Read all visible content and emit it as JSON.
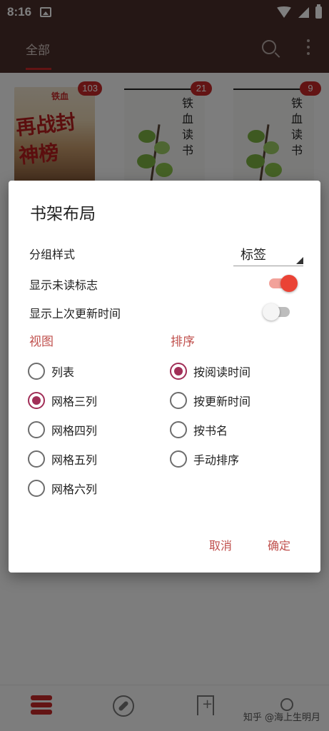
{
  "status_bar": {
    "time": "8:16"
  },
  "app_bar": {
    "tab_all": "全部"
  },
  "books": [
    {
      "brand": "铁血",
      "title": "再战封神榜",
      "badge": "103"
    },
    {
      "title": "铁血读书",
      "badge": "21"
    },
    {
      "title": "铁血读书",
      "badge": "9"
    }
  ],
  "dialog": {
    "title": "书架布局",
    "group_style_label": "分组样式",
    "group_style_value": "标签",
    "show_unread_label": "显示未读标志",
    "show_unread_on": true,
    "show_update_time_label": "显示上次更新时间",
    "show_update_time_on": false,
    "view_header": "视图",
    "view_options": [
      "列表",
      "网格三列",
      "网格四列",
      "网格五列",
      "网格六列"
    ],
    "view_selected": "网格三列",
    "sort_header": "排序",
    "sort_options": [
      "按阅读时间",
      "按更新时间",
      "按书名",
      "手动排序"
    ],
    "sort_selected": "按阅读时间",
    "cancel": "取消",
    "confirm": "确定"
  },
  "watermark": "知乎 @海上生明月",
  "colors": {
    "accent": "#c0504d",
    "radio_checked": "#a12e57",
    "switch_on": "#ea4335",
    "app_bar": "#4a2f2b"
  }
}
